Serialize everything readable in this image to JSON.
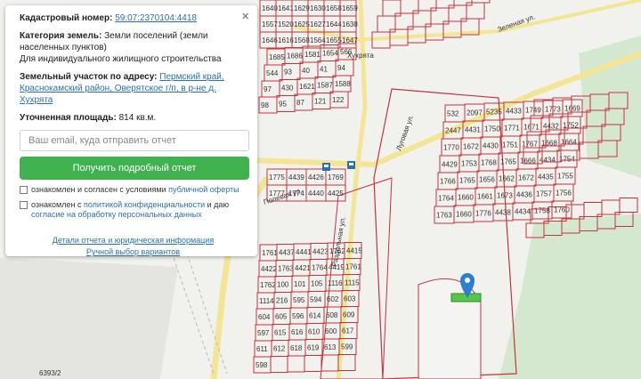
{
  "panel": {
    "close_label": "×",
    "cadastral": {
      "label": "Кадастровый номер:",
      "value": "59:07:2370104:4418"
    },
    "category": {
      "label": "Категория земель:",
      "value": "Земли поселений (земли населенных пунктов)",
      "use": "Для индивидуального жилищного строительства"
    },
    "address": {
      "label": "Земельный участок по адресу:",
      "value": "Пермский край, Краснокамский район, Оверятское г/п, в р-не д. Хухрята"
    },
    "area": {
      "label": "Уточненная площадь:",
      "value": "814 кв.м."
    },
    "email_placeholder": "Ваш email, куда отправить отчет",
    "submit_label": "Получить подробный отчет",
    "consent1": {
      "text": "ознакомлен и согласен с условиями",
      "link": "публичной оферты"
    },
    "consent2": {
      "text": "ознакомлен с",
      "link1": "политикой конфиденциальности",
      "mid": "и даю",
      "link2": "согласие на обработку персональных данных"
    },
    "details_link": "Детали отчета и юридическая информация",
    "manual_link": "Ручной выбор вариантов"
  },
  "map": {
    "streets": [
      "Хухрята",
      "Зеленая ул.",
      "Полевая ул.",
      "Раздольная ул.",
      "Луговая ул."
    ],
    "bottom_label": "6393/2",
    "marker": "location-pin-icon",
    "colors": {
      "parcel": "#c8323c",
      "selected": "#56c74b",
      "road": "#f5e88c",
      "forest": "#cfe6c9",
      "marker": "#2a7fd2"
    },
    "parcels": [
      "1640",
      "1641",
      "1629",
      "1630",
      "1658",
      "1659",
      "1557",
      "1520",
      "1625",
      "1627",
      "1644",
      "1638",
      "1646",
      "1616",
      "1568",
      "1564",
      "1655",
      "1647",
      "1685",
      "1686",
      "1581",
      "1654",
      "566",
      "544",
      "93",
      "40",
      "41",
      "94",
      "97",
      "430",
      "1621",
      "1587",
      "1588",
      "98",
      "95",
      "87",
      "121",
      "122",
      "532",
      "2097",
      "5235",
      "4433",
      "1749",
      "1773",
      "1669",
      "2447",
      "4431",
      "1750",
      "1771",
      "1671",
      "4432",
      "1752",
      "1770",
      "1672",
      "4430",
      "1751",
      "1767",
      "1668",
      "1664",
      "4429",
      "1753",
      "1768",
      "1765",
      "1666",
      "4434",
      "1754",
      "1766",
      "1765",
      "1656",
      "1662",
      "1672",
      "4435",
      "1755",
      "1764",
      "1660",
      "1661",
      "1673",
      "4436",
      "1757",
      "1756",
      "1763",
      "1660",
      "1776",
      "4438",
      "4434",
      "1758",
      "1760",
      "1775",
      "4439",
      "4426",
      "1769",
      "1777",
      "1774",
      "4440",
      "4425",
      "1761",
      "4437",
      "4441",
      "4423",
      "1762",
      "4415",
      "4422",
      "1763",
      "4421",
      "1764",
      "4419",
      "1761",
      "1762",
      "100",
      "101",
      "105",
      "1116",
      "1115",
      "1114",
      "216",
      "595",
      "594",
      "602",
      "603",
      "604",
      "605",
      "596",
      "614",
      "608",
      "609",
      "597",
      "615",
      "616",
      "610",
      "600",
      "617",
      "611",
      "612",
      "618",
      "619",
      "613",
      "599",
      "598"
    ]
  }
}
